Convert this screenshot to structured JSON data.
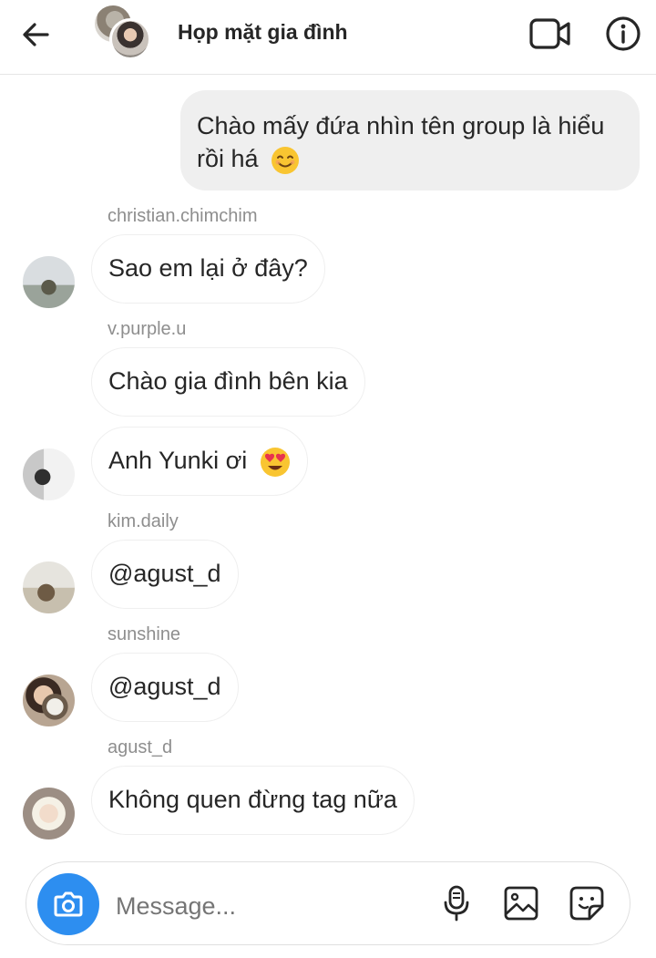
{
  "header": {
    "title": "Họp mặt gia đình",
    "back_icon": "arrow-left-icon",
    "video_icon": "video-call-icon",
    "info_icon": "info-icon"
  },
  "messages": {
    "outgoing": {
      "text": "Chào mấy đứa nhìn tên group là hiểu rồi há",
      "emoji": "smiling-face-icon"
    },
    "incoming": [
      {
        "sender": "christian.chimchim",
        "text": "Sao em lại ở đây?"
      },
      {
        "sender": "v.purple.u",
        "text": "Chào gia đình bên kia"
      },
      {
        "sender": "",
        "text": "Anh Yunki ơi",
        "emoji": "heart-eyes-icon"
      },
      {
        "sender": "kim.daily",
        "text": "@agust_d"
      },
      {
        "sender": "sunshine",
        "text": "@agust_d"
      },
      {
        "sender": "agust_d",
        "text": "Không quen đừng tag nữa"
      }
    ]
  },
  "composer": {
    "placeholder": "Message...",
    "camera_icon": "camera-icon",
    "mic_icon": "microphone-icon",
    "gallery_icon": "gallery-icon",
    "sticker_icon": "sticker-icon"
  },
  "colors": {
    "accent": "#2d8ef0",
    "bubble_out": "#efefef",
    "sender_label": "#8e8e8e"
  }
}
